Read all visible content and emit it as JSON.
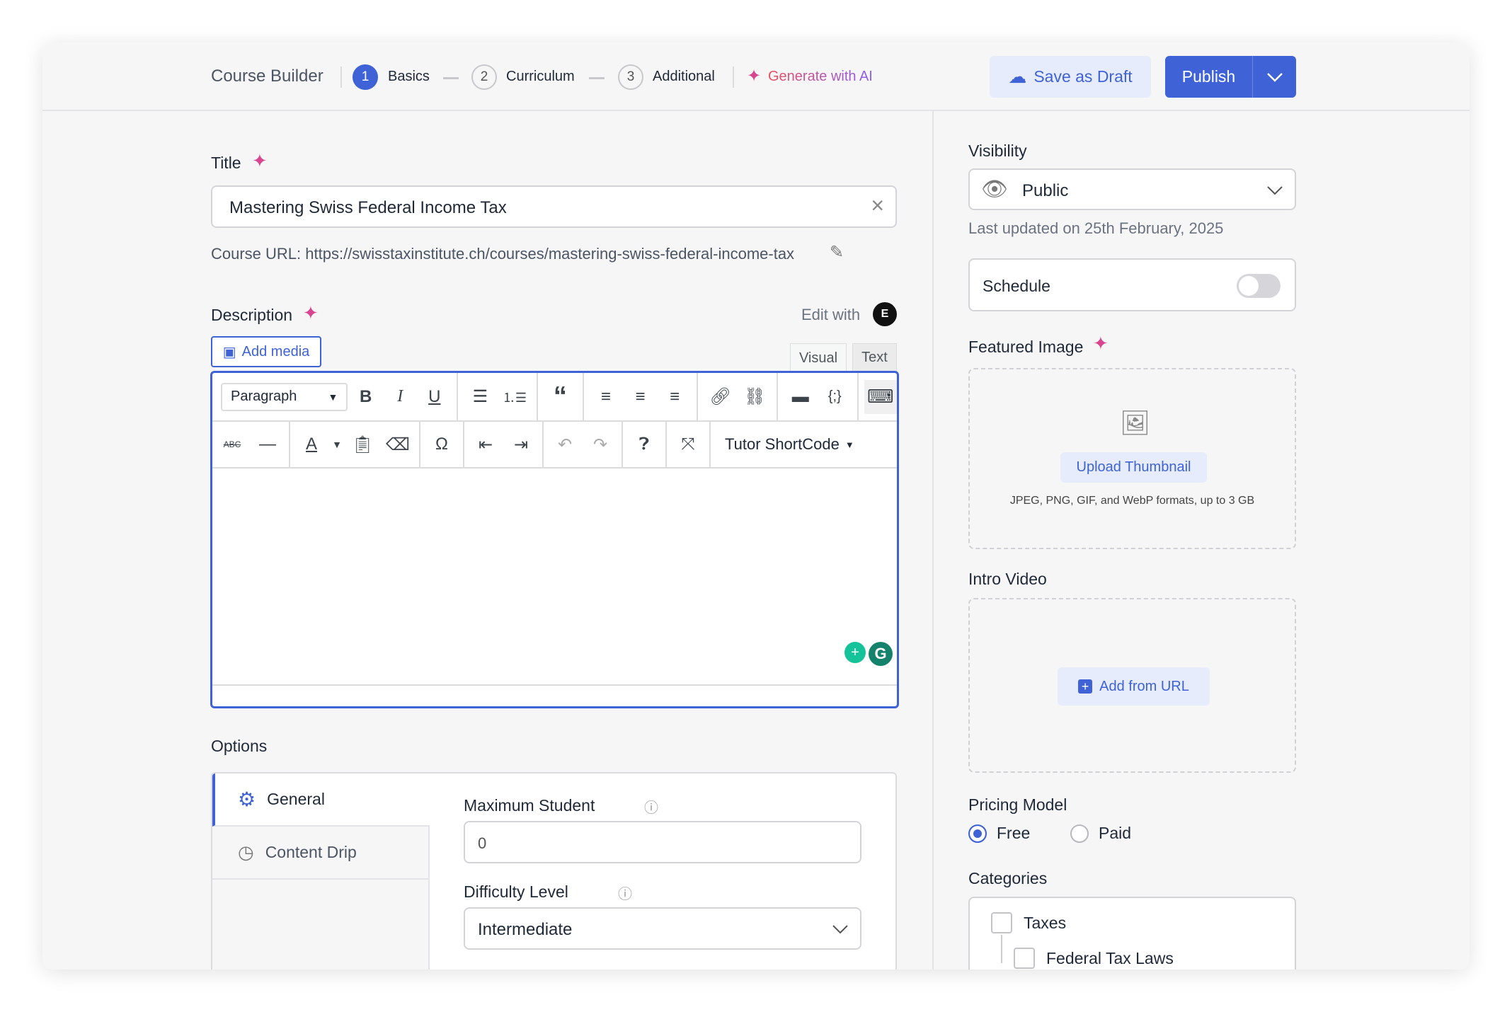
{
  "header": {
    "title": "Course Builder",
    "steps": [
      {
        "num": "1",
        "label": "Basics"
      },
      {
        "num": "2",
        "label": "Curriculum"
      },
      {
        "num": "3",
        "label": "Additional"
      }
    ],
    "generate_ai": "Generate with AI",
    "save_draft": "Save as Draft",
    "publish": "Publish"
  },
  "main": {
    "title_label": "Title",
    "title_value": "Mastering Swiss Federal Income Tax",
    "course_url": "Course URL: https://swisstaxinstitute.ch/courses/mastering-swiss-federal-income-tax",
    "description_label": "Description",
    "edit_with": "Edit with",
    "add_media": "Add media",
    "editor_tabs": {
      "visual": "Visual",
      "text": "Text"
    },
    "format_select": "Paragraph",
    "shortcode": "Tutor ShortCode",
    "options_label": "Options",
    "option_tabs": [
      {
        "label": "General"
      },
      {
        "label": "Content Drip"
      }
    ],
    "max_student_label": "Maximum Student",
    "max_student_value": "0",
    "difficulty_label": "Difficulty Level",
    "difficulty_value": "Intermediate"
  },
  "sidebar": {
    "visibility_label": "Visibility",
    "visibility_value": "Public",
    "last_updated": "Last updated on 25th February, 2025",
    "schedule_label": "Schedule",
    "schedule_on": false,
    "featured_label": "Featured Image",
    "upload_thumbnail": "Upload Thumbnail",
    "formats": "JPEG, PNG, GIF, and WebP formats, up to 3 GB",
    "intro_label": "Intro Video",
    "add_url": "Add from URL",
    "pricing_label": "Pricing Model",
    "pricing_options": [
      {
        "label": "Free",
        "selected": true
      },
      {
        "label": "Paid",
        "selected": false
      }
    ],
    "categories_label": "Categories",
    "categories": [
      {
        "label": "Taxes"
      },
      {
        "label": "Federal Tax Laws"
      }
    ]
  },
  "colors": {
    "accent": "#3f63d6",
    "ai": "#d9468f"
  }
}
